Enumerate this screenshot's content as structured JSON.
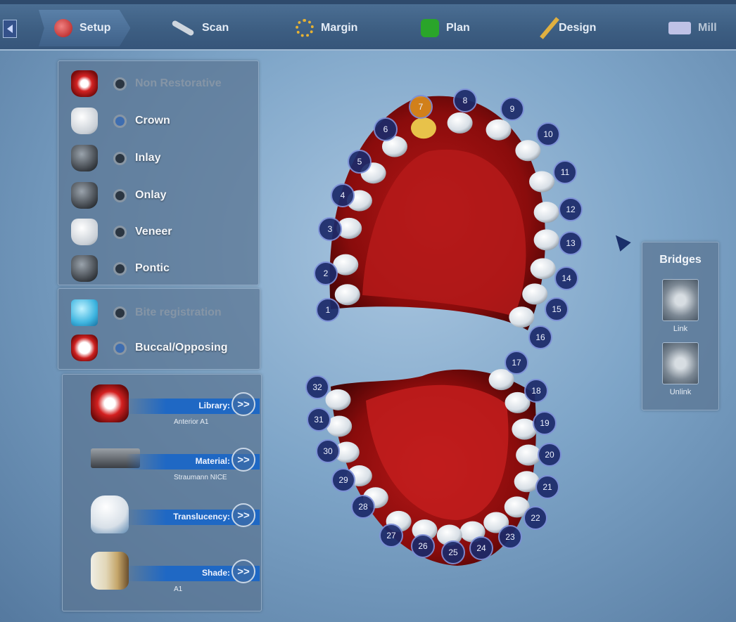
{
  "workflow": {
    "steps": [
      {
        "label": "Setup",
        "icon": "jaw-icon",
        "active": true
      },
      {
        "label": "Scan",
        "icon": "scanner-icon"
      },
      {
        "label": "Margin",
        "icon": "margin-ring-icon"
      },
      {
        "label": "Plan",
        "icon": "plan-block-icon"
      },
      {
        "label": "Design",
        "icon": "pencil-icon"
      },
      {
        "label": "Mill",
        "icon": "mill-machine-icon",
        "disabled": true
      }
    ]
  },
  "restoration_types": [
    {
      "label": "Non Restorative",
      "icon": "mouth-icon",
      "enabled": false
    },
    {
      "label": "Crown",
      "icon": "crown-icon",
      "selected": true
    },
    {
      "label": "Inlay",
      "icon": "inlay-icon"
    },
    {
      "label": "Onlay",
      "icon": "onlay-icon"
    },
    {
      "label": "Veneer",
      "icon": "veneer-icon"
    },
    {
      "label": "Pontic",
      "icon": "pontic-icon"
    }
  ],
  "registration_options": [
    {
      "label": "Bite registration",
      "icon": "bite-tray-icon",
      "enabled": false
    },
    {
      "label": "Buccal/Opposing",
      "icon": "buccal-teeth-icon",
      "selected": true
    }
  ],
  "parameters": [
    {
      "label": "Library:",
      "value": "Anterior A1",
      "icon": "library-jaw-icon",
      "button": ">>"
    },
    {
      "label": "Material:",
      "value": "Straumann NICE",
      "icon": "material-block-icon",
      "button": ">>"
    },
    {
      "label": "Translucency:",
      "value": "",
      "icon": "translucency-veneer-icon",
      "button": ">>"
    },
    {
      "label": "Shade:",
      "value": "A1",
      "icon": "shade-teeth-icon",
      "button": ">>"
    }
  ],
  "upper_teeth": [
    "1",
    "2",
    "3",
    "4",
    "5",
    "6",
    "7",
    "8",
    "9",
    "10",
    "11",
    "12",
    "13",
    "14",
    "15",
    "16"
  ],
  "lower_teeth": [
    "17",
    "18",
    "19",
    "20",
    "21",
    "22",
    "23",
    "24",
    "25",
    "26",
    "27",
    "28",
    "29",
    "30",
    "31",
    "32"
  ],
  "selected_tooth": "7",
  "bridges": {
    "title": "Bridges",
    "link_label": "Link",
    "unlink_label": "Unlink"
  },
  "colors": {
    "accent_blue": "#1f68c4",
    "selected_tooth": "#d98a1c",
    "tooth_marker": "#1c2a6a",
    "gum_red": "#a01010"
  }
}
